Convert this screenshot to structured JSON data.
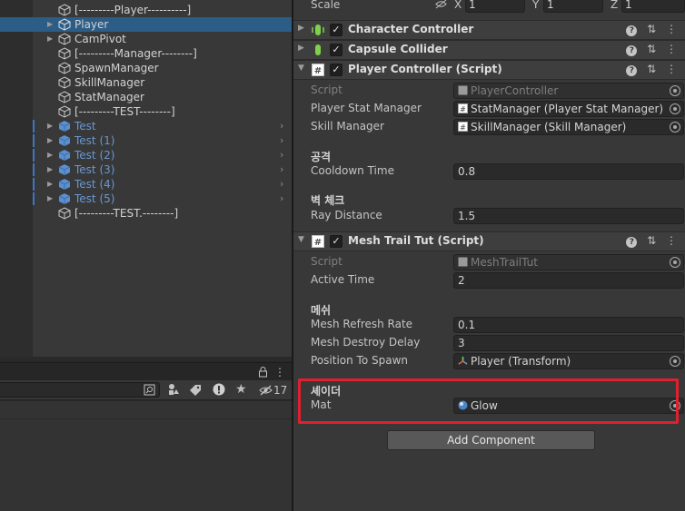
{
  "hierarchy": {
    "items": [
      {
        "label": "[---------Player----------]"
      },
      {
        "label": "Player"
      },
      {
        "label": "CamPivot"
      },
      {
        "label": "[---------Manager--------]"
      },
      {
        "label": "SpawnManager"
      },
      {
        "label": "SkillManager"
      },
      {
        "label": "StatManager"
      },
      {
        "label": "[---------TEST--------]"
      },
      {
        "label": "Test"
      },
      {
        "label": "Test (1)"
      },
      {
        "label": "Test (2)"
      },
      {
        "label": "Test (3)"
      },
      {
        "label": "Test (4)"
      },
      {
        "label": "Test (5)"
      },
      {
        "label": "[---------TEST.--------]"
      }
    ]
  },
  "project": {
    "hidden_count": "17"
  },
  "inspector": {
    "transform_scale": {
      "label": "Scale",
      "x_label": "X",
      "x": "1",
      "y_label": "Y",
      "y": "1",
      "z_label": "Z",
      "z": "1"
    },
    "components": {
      "character_controller": {
        "title": "Character Controller"
      },
      "capsule_collider": {
        "title": "Capsule Collider"
      },
      "player_controller": {
        "title": "Player Controller (Script)",
        "script_label": "Script",
        "script_value": "PlayerController",
        "stat_manager_label": "Player Stat Manager",
        "stat_manager_value": "StatManager (Player Stat Manager)",
        "skill_manager_label": "Skill Manager",
        "skill_manager_value": "SkillManager (Skill Manager)",
        "section_attack": "공격",
        "cooldown_label": "Cooldown Time",
        "cooldown_value": "0.8",
        "section_wall": "벽 체크",
        "ray_label": "Ray Distance",
        "ray_value": "1.5"
      },
      "mesh_trail": {
        "title": "Mesh Trail Tut (Script)",
        "script_label": "Script",
        "script_value": "MeshTrailTut",
        "active_time_label": "Active Time",
        "active_time_value": "2",
        "section_mesh": "메쉬",
        "refresh_label": "Mesh Refresh Rate",
        "refresh_value": "0.1",
        "destroy_label": "Mesh Destroy Delay",
        "destroy_value": "3",
        "spawn_label": "Position To Spawn",
        "spawn_value": "Player (Transform)",
        "section_shader": "셰이더",
        "mat_label": "Mat",
        "mat_value": "Glow"
      }
    },
    "add_component_label": "Add Component"
  },
  "colors": {
    "selection": "#2c5d87",
    "highlight_box": "#e0202e",
    "prefab_text": "#6a97d0"
  }
}
